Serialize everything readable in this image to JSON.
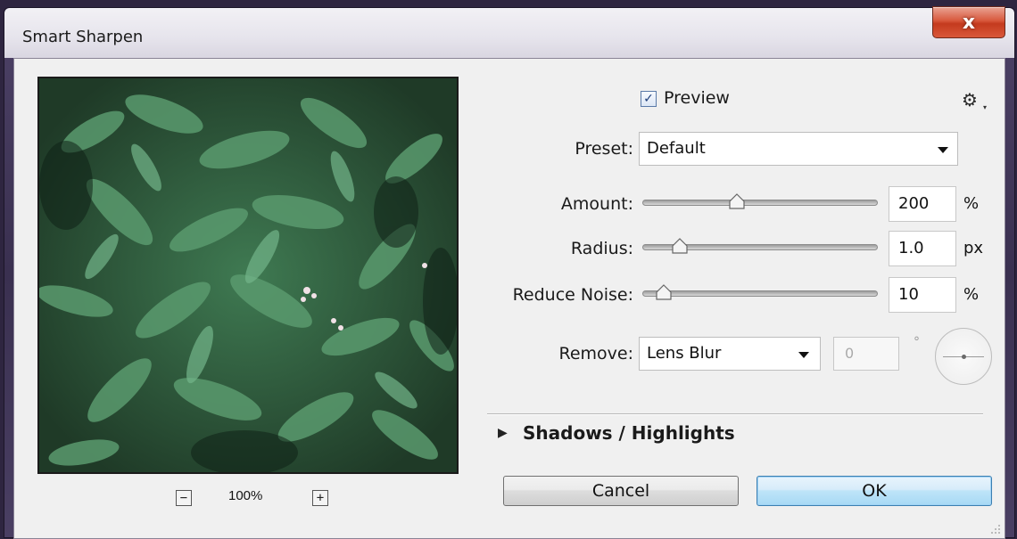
{
  "window": {
    "title": "Smart Sharpen",
    "close_label": "x"
  },
  "preview": {
    "checkbox_label": "Preview",
    "checked": true,
    "zoom_level": "100%",
    "zoom_out_label": "−",
    "zoom_in_label": "+"
  },
  "settings_icon": "gear-icon",
  "preset": {
    "label": "Preset:",
    "value": "Default"
  },
  "amount": {
    "label": "Amount:",
    "value": "200",
    "unit": "%",
    "slider_fraction": 0.4
  },
  "radius": {
    "label": "Radius:",
    "value": "1.0",
    "unit": "px",
    "slider_fraction": 0.16
  },
  "reduce_noise": {
    "label": "Reduce Noise:",
    "value": "10",
    "unit": "%",
    "slider_fraction": 0.09
  },
  "remove": {
    "label": "Remove:",
    "value": "Lens Blur",
    "angle_value": "0",
    "angle_unit": "°"
  },
  "shadows_highlights": {
    "label": "Shadows / Highlights",
    "expanded": false
  },
  "buttons": {
    "cancel": "Cancel",
    "ok": "OK"
  },
  "colors": {
    "ok_button": "#bee4f8",
    "title_bar": "#e6e4ec",
    "close_button": "#d8583c",
    "client_bg": "#f0f0f0"
  }
}
